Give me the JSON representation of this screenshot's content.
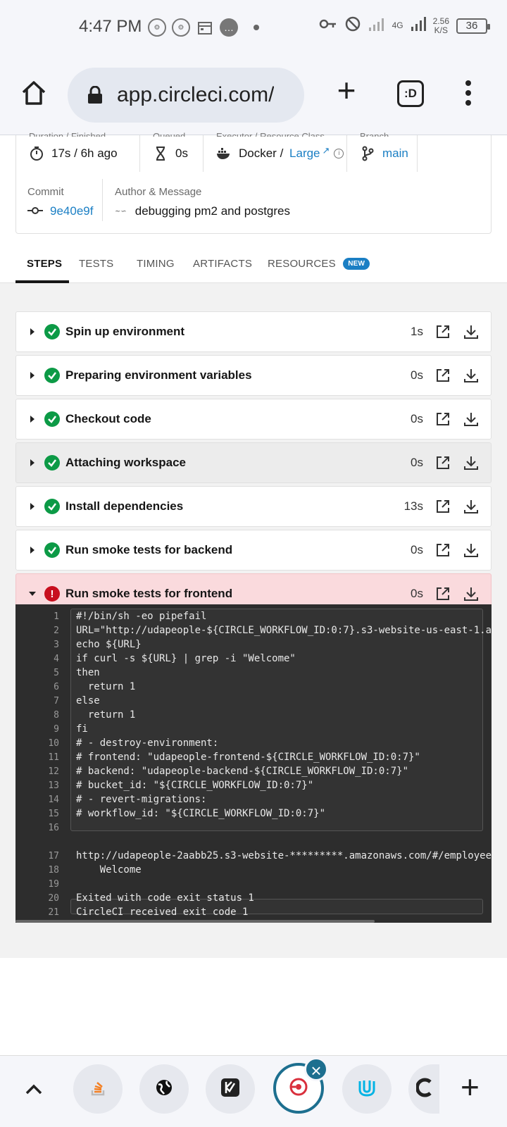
{
  "status_bar": {
    "time": "4:47 PM",
    "network": "4G",
    "speed_value": "2.56",
    "speed_unit": "K/S",
    "battery": "36"
  },
  "browser": {
    "url": "app.circleci.com/",
    "tabs_icon_text": ":D"
  },
  "job_info": {
    "duration_label": "Duration / Finished",
    "duration_value": "17s / 6h ago",
    "queued_label": "Queued",
    "queued_value": "0s",
    "executor_label": "Executor / Resource Class",
    "executor_value": "Docker / ",
    "resource_class": "Large",
    "branch_label": "Branch",
    "branch_value": "main",
    "commit_label": "Commit",
    "commit_value": "9e40e9f",
    "author_label": "Author & Message",
    "message": "debugging pm2 and postgres"
  },
  "tabs": {
    "steps": "STEPS",
    "tests": "TESTS",
    "timing": "TIMING",
    "artifacts": "ARTIFACTS",
    "resources": "RESOURCES",
    "new_badge": "NEW"
  },
  "steps": [
    {
      "label": "Spin up environment",
      "duration": "1s",
      "status": "success"
    },
    {
      "label": "Preparing environment variables",
      "duration": "0s",
      "status": "success"
    },
    {
      "label": "Checkout code",
      "duration": "0s",
      "status": "success"
    },
    {
      "label": "Attaching workspace",
      "duration": "0s",
      "status": "success"
    },
    {
      "label": "Install dependencies",
      "duration": "13s",
      "status": "success"
    },
    {
      "label": "Run smoke tests for backend",
      "duration": "0s",
      "status": "success"
    },
    {
      "label": "Run smoke tests for frontend",
      "duration": "0s",
      "status": "failed"
    }
  ],
  "console": {
    "lines": [
      {
        "n": "1",
        "text": "#!/bin/sh -eo pipefail"
      },
      {
        "n": "2",
        "text": "URL=\"http://udapeople-${CIRCLE_WORKFLOW_ID:0:7}.s3-website-us-east-1.a"
      },
      {
        "n": "3",
        "text": "echo ${URL}"
      },
      {
        "n": "4",
        "text": "if curl -s ${URL} | grep -i \"Welcome\""
      },
      {
        "n": "5",
        "text": "then"
      },
      {
        "n": "6",
        "text": "  return 1"
      },
      {
        "n": "7",
        "text": "else"
      },
      {
        "n": "8",
        "text": "  return 1"
      },
      {
        "n": "9",
        "text": "fi"
      },
      {
        "n": "10",
        "text": "# - destroy-environment:"
      },
      {
        "n": "11",
        "text": "# frontend: \"udapeople-frontend-${CIRCLE_WORKFLOW_ID:0:7}\""
      },
      {
        "n": "12",
        "text": "# backend: \"udapeople-backend-${CIRCLE_WORKFLOW_ID:0:7}\""
      },
      {
        "n": "13",
        "text": "# bucket_id: \"${CIRCLE_WORKFLOW_ID:0:7}\""
      },
      {
        "n": "14",
        "text": "# - revert-migrations:"
      },
      {
        "n": "15",
        "text": "# workflow_id: \"${CIRCLE_WORKFLOW_ID:0:7}\""
      },
      {
        "n": "16",
        "text": ""
      },
      {
        "n": "17",
        "text": "http://udapeople-2aabb25.s3-website-*********.amazonaws.com/#/employee"
      },
      {
        "n": "18",
        "text": "    Welcome"
      },
      {
        "n": "19",
        "text": ""
      },
      {
        "n": "20",
        "text": "Exited with code exit status 1"
      },
      {
        "n": "21",
        "text": "CircleCI received exit code 1"
      }
    ]
  },
  "colors": {
    "success": "#0c9a46",
    "failed": "#c80f1e",
    "link": "#1b7fc4",
    "failed_row_bg": "#fadadd",
    "console_bg": "#2d2d2d"
  }
}
